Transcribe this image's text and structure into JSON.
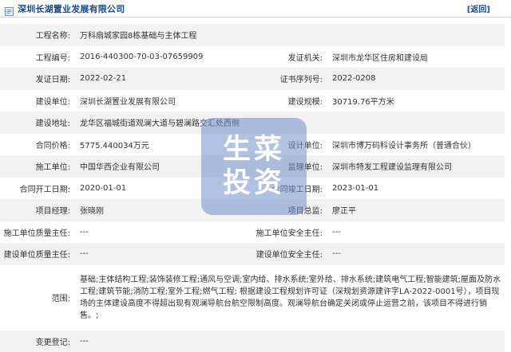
{
  "header": {
    "title": "深圳长湖置业发展有限公司",
    "back_label": "[返回]"
  },
  "fields": {
    "project_name": {
      "label": "工程名称:",
      "value": "万科扇城家园8栋基础与主体工程"
    },
    "project_no": {
      "label": "工程编号:",
      "value": "2016-440300-70-03-07659909"
    },
    "issuing_authority": {
      "label": "发证机关:",
      "value": "深圳市龙华区住房和建设局"
    },
    "issue_date": {
      "label": "发证日期:",
      "value": "2022-02-21"
    },
    "cert_serial": {
      "label": "证书序列号:",
      "value": "2022-0208"
    },
    "builder": {
      "label": "建设单位:",
      "value": "深圳长湖置业发展有限公司"
    },
    "build_scale": {
      "label": "建设规模:",
      "value": "30719.76平方米"
    },
    "address": {
      "label": "建设地址:",
      "value": "龙华区福城街道观澜大道与碧澜路交汇处西侧"
    },
    "contract_price": {
      "label": "合同价格:",
      "value": "5775.440034万元"
    },
    "design_unit": {
      "label": "设计单位:",
      "value": "深圳市博万码科设计事务所（普通合伙）"
    },
    "construction_unit": {
      "label": "施工单位:",
      "value": "中国华西企业有限公司"
    },
    "supervision_unit": {
      "label": "监理单位:",
      "value": "深圳市特发工程建设监理有限公司"
    },
    "start_date": {
      "label": "合同开工日期:",
      "value": "2020-01-01"
    },
    "finish_date": {
      "label": "合同竣工日期:",
      "value": "2023-01-01"
    },
    "project_manager": {
      "label": "项目经理:",
      "value": "张晓刚"
    },
    "chief_supervisor": {
      "label": "项目总监:",
      "value": "廖正平"
    },
    "cu_quality": {
      "label": "施工单位质量主任:",
      "value": "---"
    },
    "cu_safety": {
      "label": "施工单位安全主任:",
      "value": "---"
    },
    "bu_quality": {
      "label": "建设单位质量主任:",
      "value": "---"
    },
    "bu_safety": {
      "label": "建设单位安全主任:",
      "value": "---"
    },
    "scope": {
      "label": "范围:",
      "value": "基础;主体结构工程;装饰装修工程;通风与空调;室内给、排水系统;室外给、排水系统;建筑电气工程;智能建筑;屋面及防水工程;建筑节能;消防工程;室外工程;燃气工程; 根据建设工程规划许可证（深规划资源建许字LA-2022-0001号），项目现场的主体建设高度不得超出现有观澜导航台航空限制高度。观澜导航台确定关闭或停止运营之前，该项目不得进行销售。;"
    },
    "change_record": {
      "label": "变更登记:",
      "value": "---"
    }
  },
  "watermark": {
    "line1": "生菜",
    "line2": "投资"
  },
  "colors": {
    "header_title": "#1a4a8a",
    "back_link": "#1a4aa8",
    "row_alt_bg": "#f2f2f2",
    "watermark_bg": "#708ec8"
  }
}
